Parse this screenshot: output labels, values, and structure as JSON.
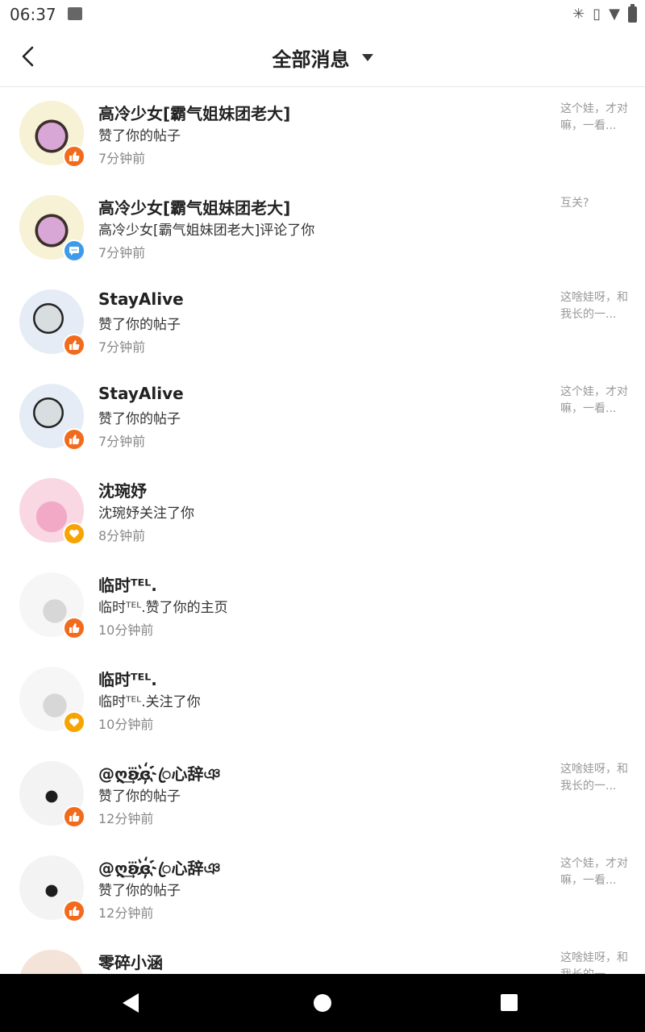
{
  "status_bar": {
    "time": "06:37"
  },
  "header": {
    "title": "全部消息"
  },
  "messages": [
    {
      "name": "高冷少女[霸气姐妹团老大]",
      "action": "赞了你的帖子",
      "time": "7分钟前",
      "excerpt": "这个娃，才对嘛，一看...",
      "badge": "like",
      "avatar": "a1"
    },
    {
      "name": "高冷少女[霸气姐妹团老大]",
      "action": "高冷少女[霸气姐妹团老大]评论了你",
      "time": "7分钟前",
      "excerpt": "互关?",
      "badge": "comment",
      "avatar": "a1"
    },
    {
      "name": "StayAlive",
      "action": "赞了你的帖子",
      "time": "7分钟前",
      "excerpt": "这啥娃呀，和我长的一...",
      "badge": "like",
      "avatar": "a2"
    },
    {
      "name": "StayAlive",
      "action": "赞了你的帖子",
      "time": "7分钟前",
      "excerpt": "这个娃，才对嘛，一看...",
      "badge": "like",
      "avatar": "a2"
    },
    {
      "name": "沈琬妤",
      "action": "沈琬妤关注了你",
      "time": "8分钟前",
      "excerpt": "",
      "badge": "follow",
      "avatar": "a3"
    },
    {
      "name": "临时ᵀᴱᴸ.",
      "action": "临时ᵀᴱᴸ.赞了你的主页",
      "time": "10分钟前",
      "excerpt": "",
      "badge": "like",
      "avatar": "a4"
    },
    {
      "name": "临时ᵀᴱᴸ.",
      "action": "临时ᵀᴱᴸ.关注了你",
      "time": "10分钟前",
      "excerpt": "",
      "badge": "follow",
      "avatar": "a4"
    },
    {
      "name": "@ღ͢ʚ⃛ɞ҉ꦿ心辞ঞ",
      "action": "赞了你的帖子",
      "time": "12分钟前",
      "excerpt": "这啥娃呀，和我长的一...",
      "badge": "like",
      "avatar": "a5"
    },
    {
      "name": "@ღ͢ʚ⃛ɞ҉ꦿ心辞ঞ",
      "action": "赞了你的帖子",
      "time": "12分钟前",
      "excerpt": "这个娃，才对嘛，一看...",
      "badge": "like",
      "avatar": "a5"
    },
    {
      "name": "零碎小涵",
      "action": "",
      "time": "",
      "excerpt": "这啥娃呀，和我长的一...",
      "badge": "",
      "avatar": "a6"
    }
  ],
  "icons": {
    "back": "chevron-left-icon",
    "dropdown": "caret-down-icon",
    "like": "thumbs-up-icon",
    "comment": "chat-bubble-icon",
    "follow": "heart-icon"
  },
  "colors": {
    "like_badge": "#f26b1d",
    "comment_badge": "#3d9be9",
    "follow_badge": "#f7a400",
    "name_text": "#222222",
    "muted_text": "#888888"
  }
}
